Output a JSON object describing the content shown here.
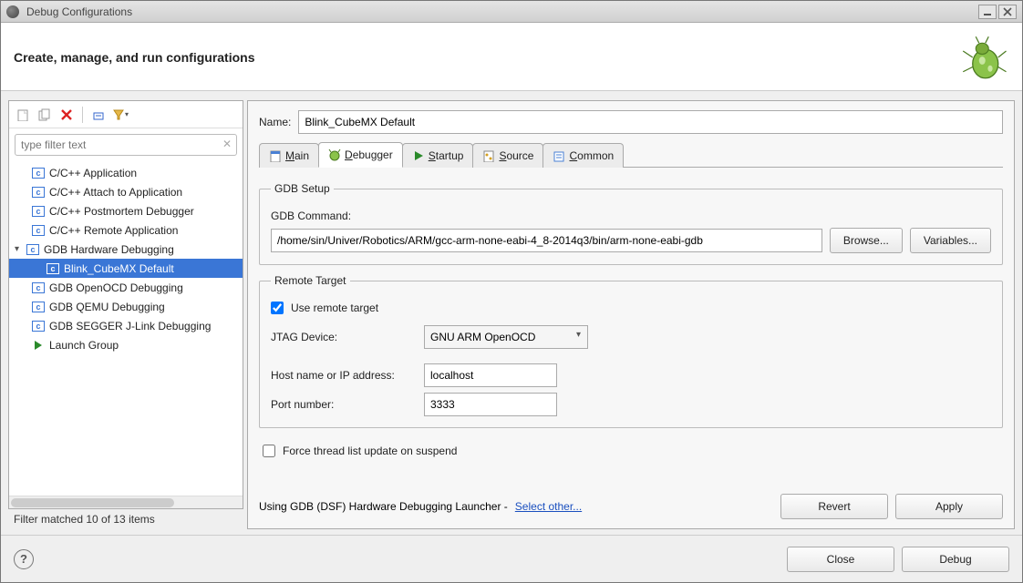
{
  "window": {
    "title": "Debug Configurations"
  },
  "header": {
    "title": "Create, manage, and run configurations"
  },
  "filter": {
    "placeholder": "type filter text",
    "status": "Filter matched 10 of 13 items"
  },
  "tree": {
    "items": [
      {
        "label": "C/C++ Application",
        "icon": "c",
        "level": 0,
        "selected": false
      },
      {
        "label": "C/C++ Attach to Application",
        "icon": "c",
        "level": 0,
        "selected": false
      },
      {
        "label": "C/C++ Postmortem Debugger",
        "icon": "c",
        "level": 0,
        "selected": false
      },
      {
        "label": "C/C++ Remote Application",
        "icon": "c",
        "level": 0,
        "selected": false
      },
      {
        "label": "GDB Hardware Debugging",
        "icon": "c",
        "level": 0,
        "selected": false,
        "expanded": true
      },
      {
        "label": "Blink_CubeMX Default",
        "icon": "c",
        "level": 1,
        "selected": true
      },
      {
        "label": "GDB OpenOCD Debugging",
        "icon": "c",
        "level": 0,
        "selected": false
      },
      {
        "label": "GDB QEMU Debugging",
        "icon": "c",
        "level": 0,
        "selected": false
      },
      {
        "label": "GDB SEGGER J-Link Debugging",
        "icon": "c",
        "level": 0,
        "selected": false
      },
      {
        "label": "Launch Group",
        "icon": "lg",
        "level": 0,
        "selected": false
      }
    ]
  },
  "name": {
    "label": "Name:",
    "value": "Blink_CubeMX Default"
  },
  "tabs": {
    "items": [
      {
        "key": "main",
        "mnemonic": "M",
        "rest": "ain"
      },
      {
        "key": "debugger",
        "mnemonic": "D",
        "rest": "ebugger",
        "active": true
      },
      {
        "key": "startup",
        "mnemonic": "S",
        "rest": "tartup"
      },
      {
        "key": "source",
        "mnemonic": "S",
        "rest": "ource"
      },
      {
        "key": "common",
        "mnemonic": "C",
        "rest": "ommon"
      }
    ]
  },
  "gdb": {
    "legend": "GDB Setup",
    "command_label": "GDB Command:",
    "command_value": "/home/sin/Univer/Robotics/ARM/gcc-arm-none-eabi-4_8-2014q3/bin/arm-none-eabi-gdb",
    "browse": "Browse...",
    "variables": "Variables..."
  },
  "remote": {
    "legend": "Remote Target",
    "use_remote": "Use remote target",
    "use_remote_checked": true,
    "jtag_label": "JTAG Device:",
    "jtag_value": "GNU ARM OpenOCD",
    "host_label": "Host name or IP address:",
    "host_value": "localhost",
    "port_label": "Port number:",
    "port_value": "3333"
  },
  "force": {
    "label": "Force thread list update on suspend",
    "checked": false
  },
  "launcher": {
    "text": "Using GDB (DSF) Hardware Debugging Launcher - ",
    "link": "Select other..."
  },
  "buttons": {
    "revert": "Revert",
    "apply": "Apply",
    "close": "Close",
    "debug": "Debug"
  }
}
